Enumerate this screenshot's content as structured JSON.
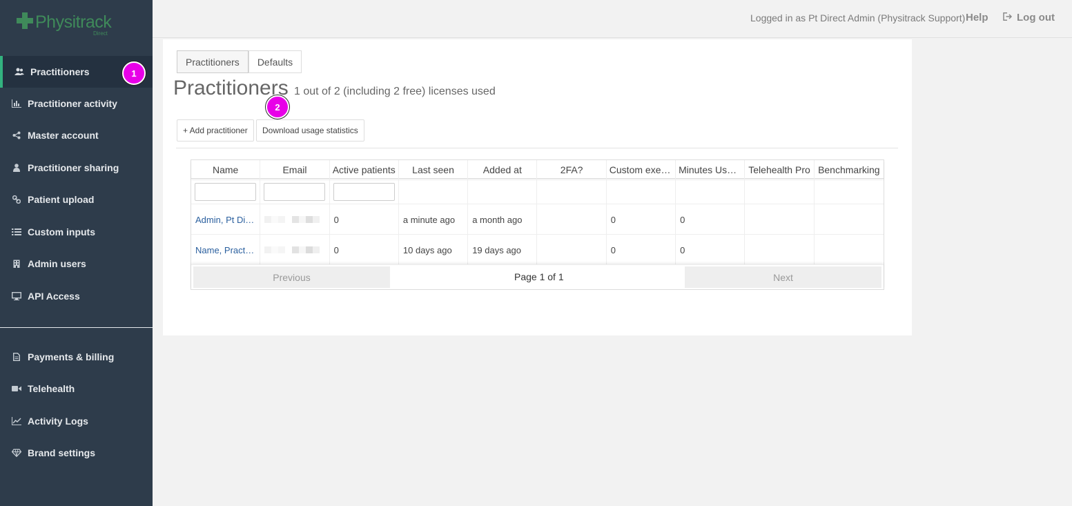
{
  "brand": {
    "name": "Physitrack",
    "sub": "Direct"
  },
  "sidebar": {
    "items": [
      {
        "label": "Practitioners",
        "icon": "users-icon"
      },
      {
        "label": "Practitioner activity",
        "icon": "bar-chart-icon"
      },
      {
        "label": "Master account",
        "icon": "share-icon"
      },
      {
        "label": "Practitioner sharing",
        "icon": "user-icon"
      },
      {
        "label": "Patient upload",
        "icon": "link-icon"
      },
      {
        "label": "Custom inputs",
        "icon": "list-icon"
      },
      {
        "label": "Admin users",
        "icon": "building-icon"
      },
      {
        "label": "API Access",
        "icon": "desktop-icon"
      },
      {
        "label": "Payments & billing",
        "icon": "document-icon"
      },
      {
        "label": "Telehealth",
        "icon": "video-camera-icon"
      },
      {
        "label": "Activity Logs",
        "icon": "line-chart-icon"
      },
      {
        "label": "Brand settings",
        "icon": "diamond-icon"
      }
    ]
  },
  "badges": [
    "1",
    "2"
  ],
  "topbar": {
    "user": "Logged in as Pt Direct Admin (Physitrack Support)",
    "help": "Help",
    "logout": "Log out"
  },
  "tabs": [
    "Practitioners",
    "Defaults"
  ],
  "page": {
    "title": "Practitioners",
    "subtitle": "1 out of 2 (including 2 free) licenses used"
  },
  "buttons": {
    "add": "+ Add practitioner",
    "download": "Download usage statistics"
  },
  "table": {
    "columns": [
      "Name",
      "Email",
      "Active patients",
      "Last seen",
      "Added at",
      "2FA?",
      "Custom exer…",
      "Minutes Use…",
      "Telehealth Pro",
      "Benchmarking"
    ],
    "rows": [
      [
        "Admin, Pt Di…",
        "",
        "0",
        "a minute ago",
        "a month ago",
        "",
        "0",
        "0",
        "",
        ""
      ],
      [
        "Name, Practi…",
        "",
        "0",
        "10 days ago",
        "19 days ago",
        "",
        "0",
        "0",
        "",
        ""
      ]
    ]
  },
  "pager": {
    "previous": "Previous",
    "info": "Page 1 of 1",
    "next": "Next"
  }
}
